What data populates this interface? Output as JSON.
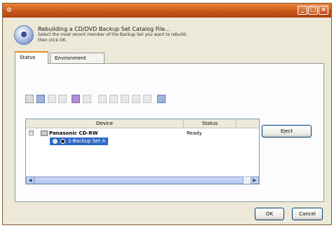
{
  "titlebar": {
    "controls": {
      "minimize": "minimize-icon",
      "maximize": "maximize-icon",
      "close": "close-icon"
    },
    "accent": "#c7561a"
  },
  "header": {
    "title": "Rebuilding a CD/DVD Backup Set Catalog File...",
    "instruction_line1": "Select the most recent member of the Backup Set you want to rebuild,",
    "instruction_line2": "then click OK."
  },
  "tabs": [
    {
      "label": "Status",
      "active": true
    },
    {
      "label": "Environment",
      "active": false
    }
  ],
  "toolbar": {
    "icons": [
      "properties-icon",
      "filter-icon",
      "filter-disabled-icon",
      "copy-disabled-icon",
      "erase-icon",
      "delete-disabled-icon",
      "media-disabled-icon-1",
      "media-disabled-icon-2",
      "media-disabled-icon-3",
      "media-disabled-icon-4",
      "media-disabled-icon-5",
      "help-icon"
    ]
  },
  "device_table": {
    "columns": [
      "Device",
      "Status"
    ],
    "rows": [
      {
        "device": "Panasonic CD-RW",
        "status": "Ready",
        "level": 0
      },
      {
        "device": "1-Backup Set A",
        "status": "",
        "level": 1,
        "selected": true
      }
    ]
  },
  "buttons": {
    "eject": "Eject",
    "ok": "OK",
    "cancel": "Cancel"
  },
  "colors": {
    "selection": "#316ac5",
    "tab_highlight": "#e68b2c",
    "window_bg": "#ece9d8"
  }
}
